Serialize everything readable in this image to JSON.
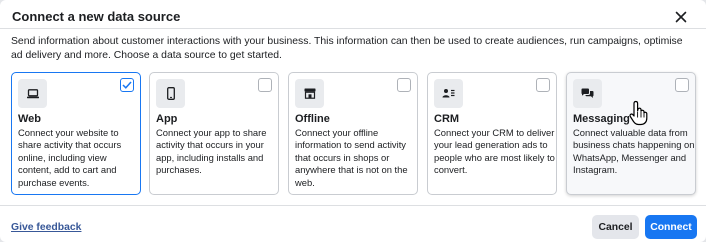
{
  "dialog": {
    "title": "Connect a new data source",
    "intro": "Send information about customer interactions with your business. This information can then be used to create audiences, run campaigns, optimise ad delivery and more. Choose a data source to get started."
  },
  "sources": [
    {
      "id": "web",
      "title": "Web",
      "description": "Connect your website to share activity that occurs online, including view content, add to cart and purchase events.",
      "icon": "laptop-icon",
      "selected": true
    },
    {
      "id": "app",
      "title": "App",
      "description": "Connect your app to share activity that occurs in your app, including installs and purchases.",
      "icon": "smartphone-icon",
      "selected": false
    },
    {
      "id": "offline",
      "title": "Offline",
      "description": "Connect your offline information to send activity that occurs in shops or anywhere that is not on the web.",
      "icon": "store-icon",
      "selected": false
    },
    {
      "id": "crm",
      "title": "CRM",
      "description": "Connect your CRM to deliver your lead generation ads to people who are most likely to convert.",
      "icon": "crm-contacts-icon",
      "selected": false
    },
    {
      "id": "messaging",
      "title": "Messaging",
      "description": "Connect valuable data from business chats happening on WhatsApp, Messenger and Instagram.",
      "icon": "chat-bubbles-icon",
      "selected": false
    }
  ],
  "footer": {
    "feedback_label": "Give feedback",
    "cancel_label": "Cancel",
    "connect_label": "Connect"
  },
  "colors": {
    "accent": "#1877f2",
    "link": "#385898",
    "icon_bg": "#e9ebee"
  }
}
